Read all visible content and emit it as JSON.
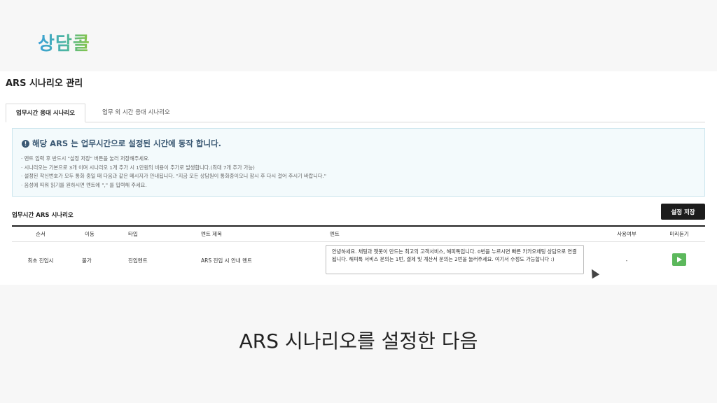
{
  "logo": "상담콜",
  "page_title": "ARS 시나리오 관리",
  "tabs": [
    "업무시간 응대 시나리오",
    "업무 외 시간 응대 시나리오"
  ],
  "notice": {
    "title": "해당 ARS 는 업무시간으로 설정된 시간에 동작 합니다.",
    "items": [
      "멘트 입력 후 반드시 \"설정 저장\" 버튼을 눌러 저장해주세요.",
      "시나리오는 기본으로 3개 이며 시나리오 1개 추가 시 1만원의 비용이 추가로 발생합니다.(최대 7개 추가 가능)",
      "설정된 착신번호가 모두 통화 중일 때 다음과 같은 메시지가 안내됩니다. \"지금 모든 상담원이 통화중이오니 잠시 후 다시 걸어 주시기 바랍니다.\"",
      "음성에 띄워 읽기를 원하시면 멘트에 \",\" 를 입력해 주세요."
    ]
  },
  "section_title": "업무시간 ARS 시나리오",
  "save_button": "설정 저장",
  "table": {
    "headers": [
      "순서",
      "이동",
      "타입",
      "멘트 제목",
      "멘트",
      "사용여부",
      "미리듣기"
    ],
    "rows": [
      {
        "order": "최초 진입시",
        "move": "불가",
        "type": "진입멘트",
        "title": "ARS 진입 시 안내 멘트",
        "comment": "안녕하세요. 채팅과 챗봇이 만드는 최고의 고객서비스, 해피톡입니다. 0번을 누르시면 빠른 카카오채팅 상담으로 연결됩니다. 해피톡 서비스 문의는 1번, 결제 및 계산서 문의는 2번을 눌러주세요. 여기서 수정도 가능합니다 :)",
        "usage": "-"
      }
    ]
  },
  "caption": "ARS 시나리오를 설정한 다음",
  "colors": {
    "accent_dark": "#1c1c1c",
    "play_green": "#5cb85c",
    "notice_bg": "#f3fafc"
  },
  "icons": [
    "info-icon",
    "play-icon",
    "mouse-cursor-icon"
  ]
}
